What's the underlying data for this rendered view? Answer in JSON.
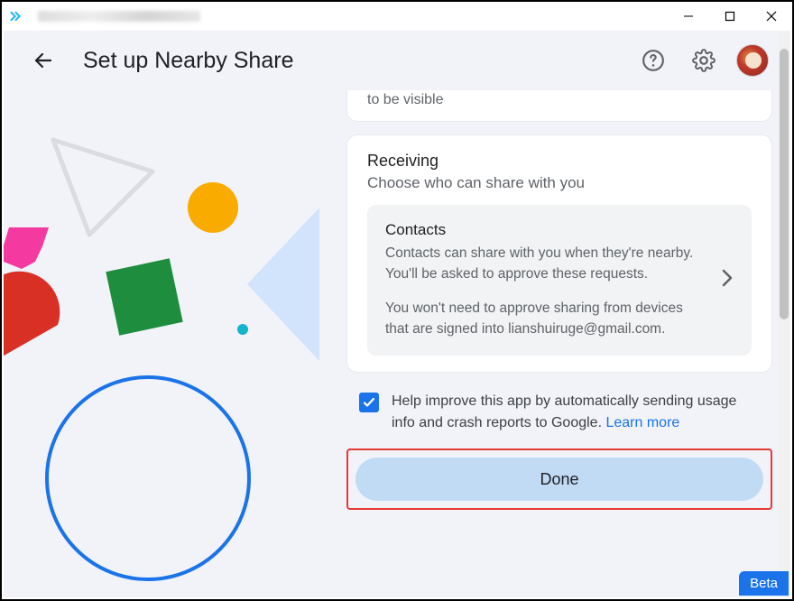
{
  "window": {
    "minimize": "–",
    "maximize": "☐",
    "close": "✕"
  },
  "header": {
    "title": "Set up Nearby Share"
  },
  "clipped_card_text": "to be visible",
  "receiving": {
    "title": "Receiving",
    "subtitle": "Choose who can share with you",
    "option": {
      "name": "Contacts",
      "desc1": "Contacts can share with you when they're nearby. You'll be asked to approve these requests.",
      "desc2": "You won't need to approve sharing from devices that are signed into lianshuiruge@gmail.com."
    }
  },
  "checkbox": {
    "label": "Help improve this app by automatically sending usage info and crash reports to Google. ",
    "link": "Learn more"
  },
  "done_label": "Done",
  "beta_label": "Beta"
}
